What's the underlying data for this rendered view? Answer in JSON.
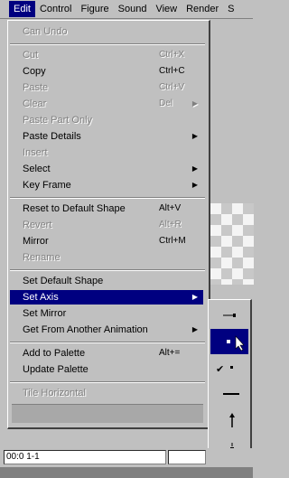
{
  "menubar": [
    "Edit",
    "Control",
    "Figure",
    "Sound",
    "View",
    "Render",
    "S"
  ],
  "menu": [
    {
      "label": "Can Undo",
      "disabled": true
    },
    {
      "sep": true
    },
    {
      "label": "Cut",
      "shortcut": "Ctrl+X",
      "disabled": true
    },
    {
      "label": "Copy",
      "shortcut": "Ctrl+C"
    },
    {
      "label": "Paste",
      "shortcut": "Ctrl+V",
      "disabled": true
    },
    {
      "label": "Clear",
      "shortcut": "Del",
      "disabled": true,
      "arrow": true
    },
    {
      "label": "Paste Part Only",
      "disabled": true
    },
    {
      "label": "Paste Details",
      "arrow": true
    },
    {
      "label": "Insert",
      "disabled": true
    },
    {
      "label": "Select",
      "arrow": true
    },
    {
      "label": "Key Frame",
      "arrow": true
    },
    {
      "sep": true
    },
    {
      "label": "Reset to Default Shape",
      "shortcut": "Alt+V"
    },
    {
      "label": "Revert",
      "shortcut": "Alt+R",
      "disabled": true
    },
    {
      "label": "Mirror",
      "shortcut": "Ctrl+M"
    },
    {
      "label": "Rename",
      "disabled": true
    },
    {
      "sep": true
    },
    {
      "label": "Set Default Shape"
    },
    {
      "label": "Set Axis",
      "arrow": true,
      "selected": true
    },
    {
      "label": "Set Mirror"
    },
    {
      "label": "Get From Another Animation",
      "arrow": true
    },
    {
      "sep": true
    },
    {
      "label": "Add to Palette",
      "shortcut": "Alt+="
    },
    {
      "label": "Update Palette"
    },
    {
      "sep": true
    },
    {
      "label": "Tile Horizontal",
      "disabled": true
    }
  ],
  "axis_submenu": [
    {
      "icon": "axis-left-icon"
    },
    {
      "icon": "axis-up-icon",
      "selected": true
    },
    {
      "icon": "axis-dot-icon",
      "checked": true
    },
    {
      "icon": "axis-right-icon"
    },
    {
      "icon": "axis-vertical-icon"
    },
    {
      "icon": "axis-point-icon"
    }
  ],
  "status": {
    "field": "00:0 1-1"
  }
}
